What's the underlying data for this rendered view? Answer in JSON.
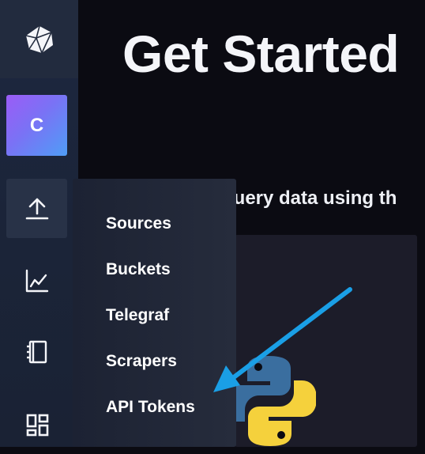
{
  "header": {
    "title": "Get Started",
    "subtitle_partial": "query data using th"
  },
  "sidebar": {
    "logo_icon": "influxdb-cube-icon",
    "org_initial": "C",
    "items": [
      {
        "name": "load-data",
        "icon": "upload-icon",
        "active": true
      },
      {
        "name": "data-explorer",
        "icon": "graph-icon",
        "active": false
      },
      {
        "name": "notebooks",
        "icon": "notebook-icon",
        "active": false
      },
      {
        "name": "dashboards",
        "icon": "dashboard-icon",
        "active": false
      }
    ]
  },
  "load_data_menu": {
    "items": [
      {
        "label": "Sources"
      },
      {
        "label": "Buckets"
      },
      {
        "label": "Telegraf"
      },
      {
        "label": "Scrapers"
      },
      {
        "label": "API Tokens"
      }
    ]
  },
  "card": {
    "icon": "python-logo-icon"
  },
  "annotation": {
    "icon": "arrow-pointer-icon",
    "color": "#1a9fe6"
  },
  "colors": {
    "avatar_gradient_start": "#9b5cf6",
    "avatar_gradient_end": "#4f9df6",
    "python_blue": "#3a6e9f",
    "python_yellow": "#f5d13c"
  }
}
